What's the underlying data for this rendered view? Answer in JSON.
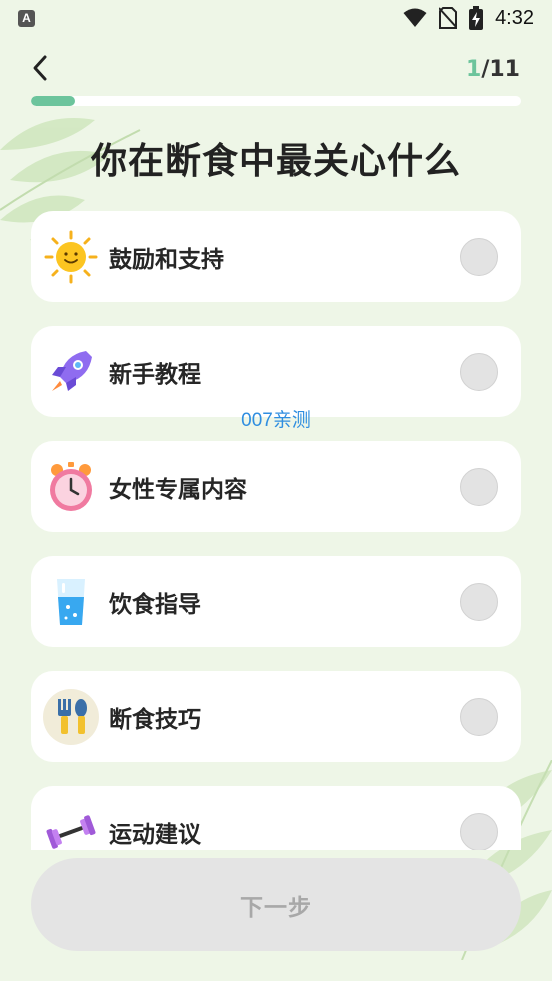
{
  "status_bar": {
    "app_icon_letter": "A",
    "time": "4:32",
    "icons": [
      "wifi-icon",
      "no-sim-icon",
      "battery-charging-icon"
    ]
  },
  "header": {
    "back_icon": "chevron-left-icon",
    "step_current": "1",
    "step_total": "/11",
    "progress_fraction": 0.09
  },
  "title": "你在断食中最关心什么",
  "watermark": "007亲测",
  "options": [
    {
      "label": "鼓励和支持",
      "icon": "sun-smile-icon",
      "selected": false
    },
    {
      "label": "新手教程",
      "icon": "rocket-icon",
      "selected": false
    },
    {
      "label": "女性专属内容",
      "icon": "alarm-clock-icon",
      "selected": false
    },
    {
      "label": "饮食指导",
      "icon": "water-glass-icon",
      "selected": false
    },
    {
      "label": "断食技巧",
      "icon": "fork-spoon-icon",
      "selected": false
    },
    {
      "label": "运动建议",
      "icon": "dumbbell-icon",
      "selected": false
    }
  ],
  "next_button": "下一步",
  "colors": {
    "background": "#eef6e7",
    "accent": "#6cc49c",
    "card": "#ffffff",
    "radio": "#e3e3e3",
    "button_disabled": "#e4e4e4",
    "watermark": "#2f8ee0"
  }
}
